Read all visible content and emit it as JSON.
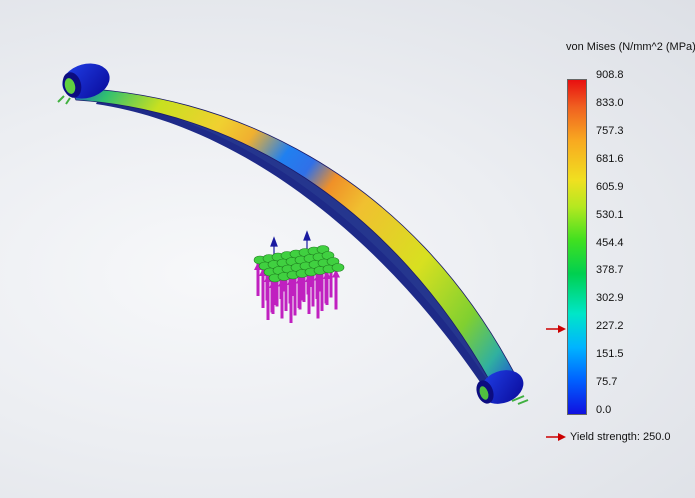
{
  "legend": {
    "title": "von Mises (N/mm^2 (MPa))",
    "ticks": [
      "908.8",
      "833.0",
      "757.3",
      "681.6",
      "605.9",
      "530.1",
      "454.4",
      "378.7",
      "302.9",
      "227.2",
      "151.5",
      "75.7",
      "0.0"
    ],
    "max": 908.8,
    "min": 0.0
  },
  "yield": {
    "label": "Yield strength: 250.0",
    "value": 250.0,
    "marker_color": "#cc0000"
  },
  "colors": {
    "fixture_arrows": "#c020c0",
    "fixture_base": "#40d040",
    "triad": "#1a1aa0"
  }
}
